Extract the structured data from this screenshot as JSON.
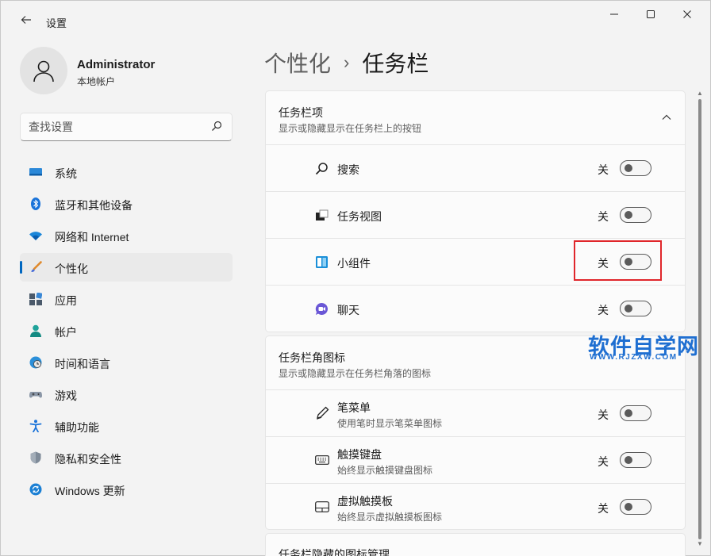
{
  "window": {
    "title": "设置",
    "controls": {
      "minimize": "—",
      "maximize": "☐",
      "close": "✕"
    }
  },
  "profile": {
    "name": "Administrator",
    "type": "本地帐户"
  },
  "search": {
    "placeholder": "查找设置"
  },
  "sidebar": {
    "items": [
      {
        "label": "系统",
        "icon": "system-icon"
      },
      {
        "label": "蓝牙和其他设备",
        "icon": "bluetooth-icon"
      },
      {
        "label": "网络和 Internet",
        "icon": "wifi-icon"
      },
      {
        "label": "个性化",
        "icon": "brush-icon",
        "active": true
      },
      {
        "label": "应用",
        "icon": "apps-icon"
      },
      {
        "label": "帐户",
        "icon": "account-icon"
      },
      {
        "label": "时间和语言",
        "icon": "globe-clock-icon"
      },
      {
        "label": "游戏",
        "icon": "gamepad-icon"
      },
      {
        "label": "辅助功能",
        "icon": "accessibility-icon"
      },
      {
        "label": "隐私和安全性",
        "icon": "shield-icon"
      },
      {
        "label": "Windows 更新",
        "icon": "update-icon"
      }
    ]
  },
  "breadcrumb": {
    "parent": "个性化",
    "separator": "›",
    "current": "任务栏"
  },
  "taskbar_items": {
    "title": "任务栏项",
    "subtitle": "显示或隐藏显示在任务栏上的按钮",
    "rows": [
      {
        "label": "搜索",
        "state": "关",
        "icon": "search-icon"
      },
      {
        "label": "任务视图",
        "state": "关",
        "icon": "task-view-icon"
      },
      {
        "label": "小组件",
        "state": "关",
        "icon": "widgets-icon"
      },
      {
        "label": "聊天",
        "state": "关",
        "icon": "chat-icon"
      }
    ]
  },
  "corner_icons": {
    "title": "任务栏角图标",
    "subtitle": "显示或隐藏显示在任务栏角落的图标",
    "rows": [
      {
        "label": "笔菜单",
        "desc": "使用笔时显示笔菜单图标",
        "state": "关",
        "icon": "pen-icon"
      },
      {
        "label": "触摸键盘",
        "desc": "始终显示触摸键盘图标",
        "state": "关",
        "icon": "keyboard-icon"
      },
      {
        "label": "虚拟触摸板",
        "desc": "始终显示虚拟触摸板图标",
        "state": "关",
        "icon": "touchpad-icon"
      }
    ]
  },
  "partial_section": {
    "title": "任务栏隐藏的图标管理"
  },
  "watermark": {
    "main": "软件自学网",
    "sub": "WWW.RJZXW.COM"
  },
  "colors": {
    "accent": "#0067c0",
    "highlight": "#e0262b",
    "watermark": "#1f6fd1"
  }
}
